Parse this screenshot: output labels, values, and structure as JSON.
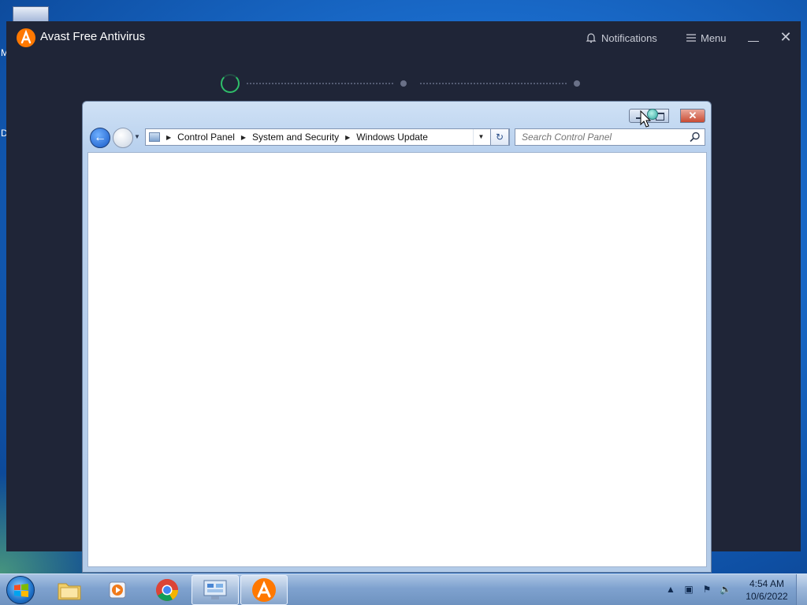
{
  "avast": {
    "title": "Avast Free Antivirus",
    "notifications_label": "Notifications",
    "menu_label": "Menu",
    "close_glyph": "✕"
  },
  "explorer": {
    "breadcrumb": [
      "Control Panel",
      "System and Security",
      "Windows Update"
    ],
    "search_placeholder": "Search Control Panel",
    "close_glyph": "✕",
    "back_glyph": "←",
    "refresh_glyph": "↻"
  },
  "desktop": {
    "edge_letters": [
      "M",
      "D"
    ]
  },
  "taskbar": {
    "pinned": [
      "windows-explorer",
      "media-player",
      "chrome",
      "control-panel",
      "avast"
    ],
    "active": "avast",
    "clock_time": "4:54 AM",
    "clock_date": "10/6/2022"
  },
  "colors": {
    "avast_bg": "#1f2537",
    "avast_accent": "#ff7800",
    "spinner": "#2fbf6a",
    "close_red": "#c94b33"
  }
}
